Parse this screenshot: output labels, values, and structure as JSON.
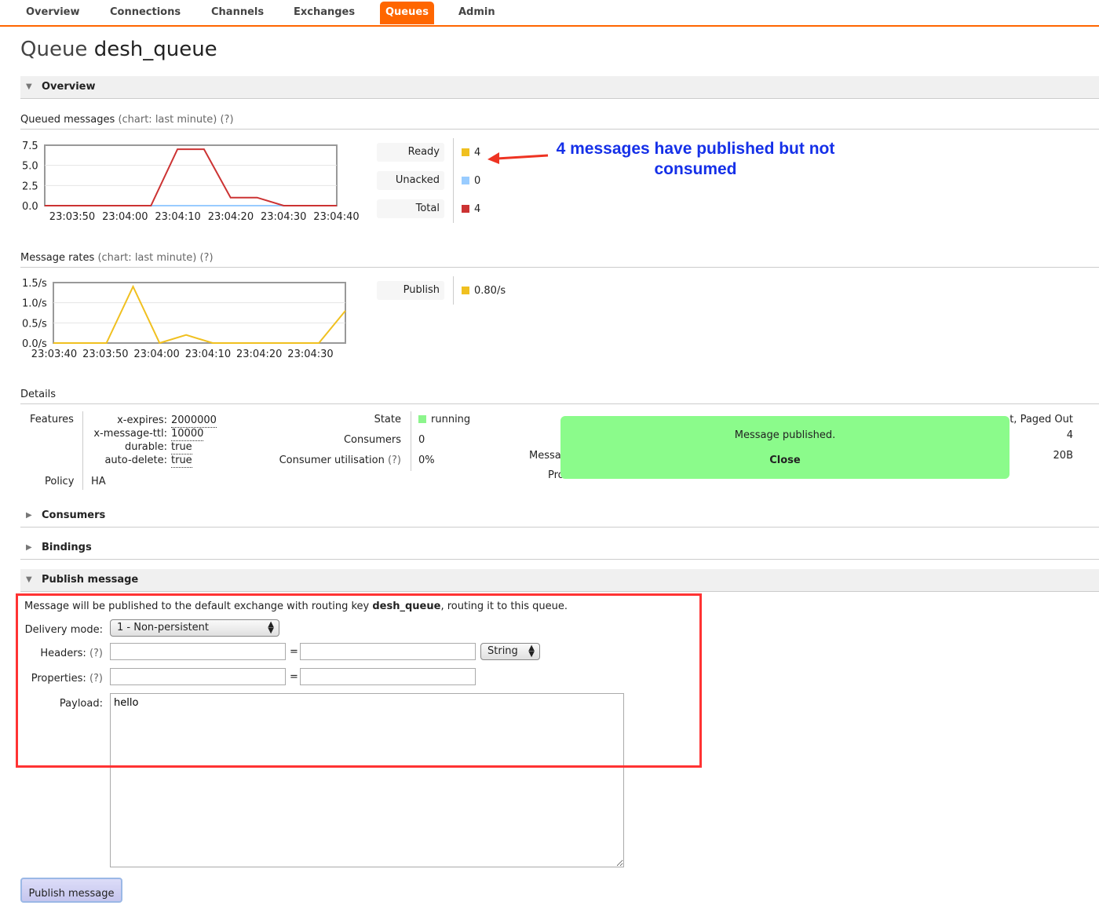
{
  "nav": {
    "overview": "Overview",
    "connections": "Connections",
    "channels": "Channels",
    "exchanges": "Exchanges",
    "queues": "Queues",
    "admin": "Admin"
  },
  "page": {
    "title_label": "Queue",
    "queue_name": "desh_queue"
  },
  "sections": {
    "overview": "Overview",
    "consumers": "Consumers",
    "bindings": "Bindings",
    "publish": "Publish message"
  },
  "queued": {
    "heading": "Queued messages",
    "chart_note": "(chart: last minute)",
    "help": "(?)",
    "legend": [
      {
        "label": "Ready",
        "value": "4",
        "color": "#f0c020"
      },
      {
        "label": "Unacked",
        "value": "0",
        "color": "#99ccff"
      },
      {
        "label": "Total",
        "value": "4",
        "color": "#cc3333"
      }
    ]
  },
  "rates": {
    "heading": "Message rates",
    "chart_note": "(chart: last minute)",
    "help": "(?)",
    "legend": [
      {
        "label": "Publish",
        "value": "0.80/s",
        "color": "#f0c020"
      }
    ]
  },
  "annotation": {
    "line1": "4 messages have published but not",
    "line2": "consumed",
    "color": "#1530e8"
  },
  "chart_data": [
    {
      "type": "line",
      "yticks": [
        "7.5",
        "5.0",
        "2.5",
        "0.0"
      ],
      "xticks": [
        "23:03:50",
        "23:04:00",
        "23:04:10",
        "23:04:20",
        "23:04:30",
        "23:04:40"
      ],
      "ylim": [
        0,
        7.5
      ],
      "series": [
        {
          "name": "Total",
          "color": "#cc3333",
          "x": [
            0,
            5,
            10,
            15,
            20,
            25,
            30,
            35,
            40,
            45,
            50,
            55
          ],
          "values": [
            0,
            0,
            0,
            0,
            0,
            7,
            7,
            1,
            1,
            0,
            0,
            0
          ]
        },
        {
          "name": "Unacked",
          "color": "#99ccff",
          "x": [
            0,
            55
          ],
          "values": [
            0,
            0
          ]
        }
      ]
    },
    {
      "type": "line",
      "yticks": [
        "1.5/s",
        "1.0/s",
        "0.5/s",
        "0.0/s"
      ],
      "xticks": [
        "23:03:40",
        "23:03:50",
        "23:04:00",
        "23:04:10",
        "23:04:20",
        "23:04:30"
      ],
      "ylim": [
        0,
        1.5
      ],
      "series": [
        {
          "name": "Publish",
          "color": "#f0c020",
          "x": [
            0,
            5,
            10,
            15,
            20,
            25,
            30,
            35,
            40,
            45,
            50,
            55
          ],
          "values": [
            0,
            0,
            0,
            1.4,
            0,
            0.2,
            0,
            0,
            0,
            0,
            0,
            0.8
          ]
        }
      ]
    }
  ],
  "details": {
    "heading": "Details",
    "features_label": "Features",
    "features": [
      {
        "key": "x-expires:",
        "value": "2000000"
      },
      {
        "key": "x-message-ttl:",
        "value": "10000"
      },
      {
        "key": "durable:",
        "value": "true"
      },
      {
        "key": "auto-delete:",
        "value": "true"
      }
    ],
    "policy_label": "Policy",
    "policy_value": "HA",
    "state_label": "State",
    "state_value": "running",
    "consumers_label": "Consumers",
    "consumers_value": "0",
    "util_label": "Consumer utilisation",
    "util_help": "(?)",
    "util_value": "0%",
    "msg_partial": "Messa",
    "proc_partial": "Process memory",
    "proc_help": "(?)",
    "right_header_partial": "t, Paged Out",
    "right_val1": "4",
    "right_val2": "20B"
  },
  "notice": {
    "message": "Message published.",
    "close": "Close"
  },
  "publish": {
    "intro_before": "Message will be published to the default exchange with routing key ",
    "routing_key": "desh_queue",
    "intro_after": ", routing it to this queue.",
    "delivery_label": "Delivery mode:",
    "delivery_value": "1 - Non-persistent",
    "headers_label": "Headers:",
    "headers_help": "(?)",
    "header_type": "String",
    "properties_label": "Properties:",
    "properties_help": "(?)",
    "equals": "=",
    "payload_label": "Payload:",
    "payload_value": "hello",
    "button": "Publish message"
  }
}
